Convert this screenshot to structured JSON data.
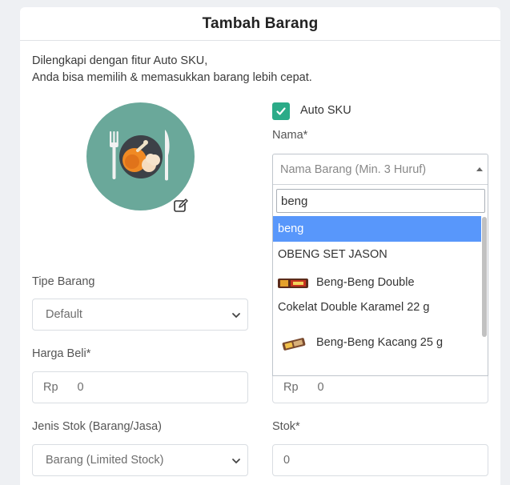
{
  "title": "Tambah Barang",
  "description": {
    "line1": "Dilengkapi dengan fitur Auto SKU,",
    "line2": "Anda bisa memilih & memasukkan barang lebih cepat."
  },
  "auto_sku": {
    "label": "Auto SKU",
    "checked": true
  },
  "nama": {
    "label": "Nama*",
    "placeholder": "Nama Barang (Min. 3 Huruf)",
    "search_value": "beng",
    "options": [
      {
        "label": "beng",
        "highlighted": true
      },
      {
        "label": "OBENG SET JASON"
      },
      {
        "label_line1": "Beng-Beng Double",
        "label_line2": "Cokelat Double Karamel 22 g",
        "icon": "beng-beng-double-wrapper-icon"
      },
      {
        "label_line1": "Beng-Beng Kacang 25 g",
        "icon": "beng-beng-kacang-wrapper-icon"
      }
    ]
  },
  "tipe_barang": {
    "label": "Tipe Barang",
    "value": "Default"
  },
  "harga_beli": {
    "label": "Harga Beli*",
    "prefix": "Rp",
    "value": "0"
  },
  "harga_jual": {
    "prefix": "Rp",
    "value": "0"
  },
  "jenis_stok": {
    "label": "Jenis Stok (Barang/Jasa)",
    "value": "Barang (Limited Stock)"
  },
  "stok": {
    "label": "Stok*",
    "value": "0"
  },
  "colors": {
    "accent": "#2bab88",
    "highlight": "#5897fb",
    "avatar_bg": "#6aa89a"
  },
  "icons": {
    "avatar": "plate-food-icon",
    "edit": "edit-icon",
    "check": "check-icon"
  }
}
